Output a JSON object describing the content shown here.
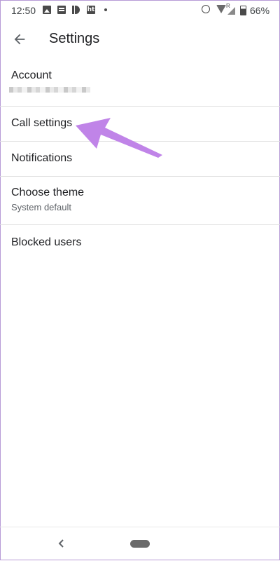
{
  "status_bar": {
    "time": "12:50",
    "battery": "66%",
    "icons": [
      "gallery-icon",
      "message-icon",
      "id-app-icon",
      "ht-app-icon",
      "dot-icon",
      "alarm-icon",
      "wifi-icon",
      "signal-icon",
      "battery-icon"
    ],
    "roaming_label": "R",
    "ht_label": "ht"
  },
  "app_bar": {
    "title": "Settings",
    "back_icon": "arrow-back-icon"
  },
  "settings": {
    "items": [
      {
        "title": "Account",
        "subtitle": ""
      },
      {
        "title": "Call settings"
      },
      {
        "title": "Notifications"
      },
      {
        "title": "Choose theme",
        "subtitle": "System default"
      },
      {
        "title": "Blocked users"
      }
    ]
  },
  "annotation": {
    "color": "#c084e8",
    "points_to": "Call settings"
  },
  "nav_bar": {
    "back_icon": "chevron-left-icon",
    "home_icon": "home-pill-icon"
  }
}
